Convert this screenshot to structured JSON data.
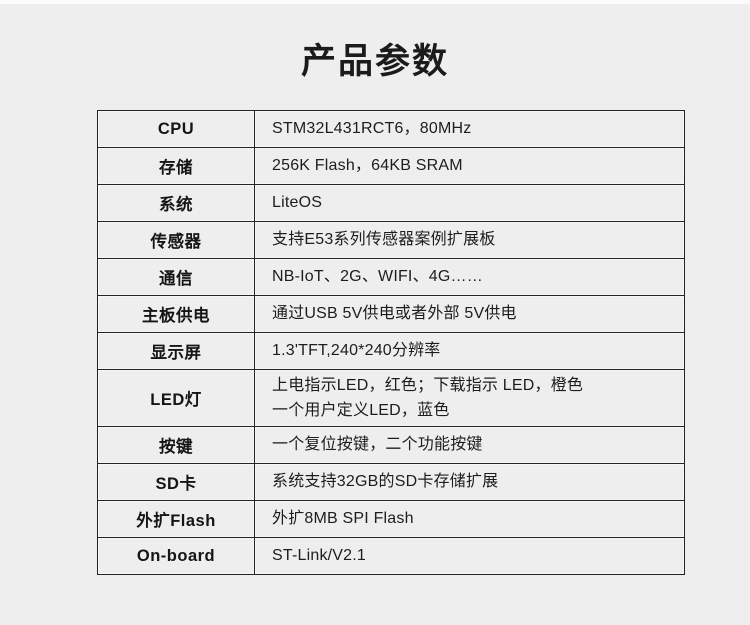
{
  "page": {
    "background_color": "#eeeeee",
    "title": "产品参数"
  },
  "spec_table": {
    "rows": [
      {
        "label": "CPU",
        "value": "STM32L431RCT6，80MHz"
      },
      {
        "label": "存储",
        "value": "256K Flash，64KB SRAM"
      },
      {
        "label": "系统",
        "value": "LiteOS"
      },
      {
        "label": "传感器",
        "value": "支持E53系列传感器案例扩展板"
      },
      {
        "label": "通信",
        "value": "NB-IoT、2G、WIFI、4G……"
      },
      {
        "label": "主板供电",
        "value": "通过USB 5V供电或者外部 5V供电"
      },
      {
        "label": "显示屏",
        "value": "1.3'TFT,240*240分辨率"
      },
      {
        "label": "LED灯",
        "value": "上电指示LED，红色；下载指示 LED，橙色\n一个用户定义LED，蓝色",
        "tall": true
      },
      {
        "label": "按键",
        "value": "一个复位按键，二个功能按键"
      },
      {
        "label": "SD卡",
        "value": "系统支持32GB的SD卡存储扩展"
      },
      {
        "label": "外扩Flash",
        "value": "外扩8MB SPI Flash"
      },
      {
        "label": "On-board",
        "value": "ST-Link/V2.1"
      }
    ]
  }
}
